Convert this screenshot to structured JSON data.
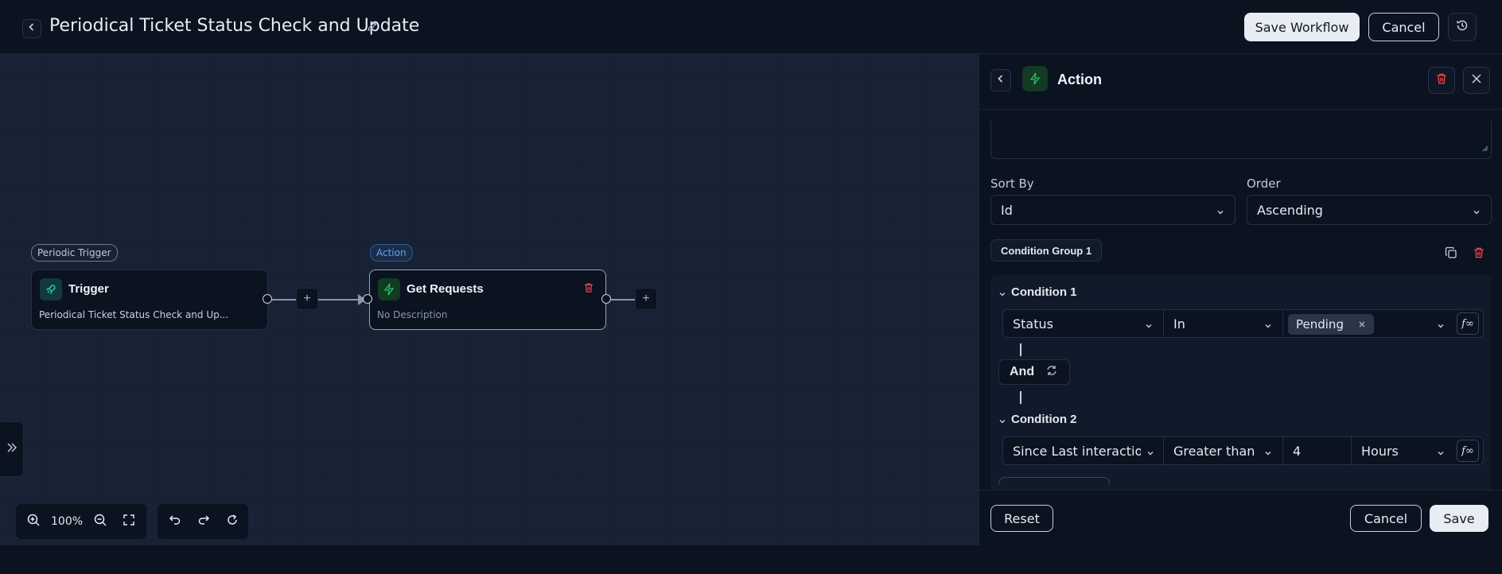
{
  "header": {
    "title": "Periodical Ticket Status Check and Update",
    "save_workflow": "Save Workflow",
    "cancel": "Cancel"
  },
  "canvas": {
    "trigger_node": {
      "pill": "Periodic Trigger",
      "title": "Trigger",
      "subtitle": "Periodical Ticket Status Check and Up..."
    },
    "action_node": {
      "pill": "Action",
      "title": "Get Requests",
      "subtitle": "No Description"
    },
    "zoom_level": "100%"
  },
  "panel": {
    "title": "Action",
    "sort_by_label": "Sort By",
    "sort_by_value": "Id",
    "order_label": "Order",
    "order_value": "Ascending",
    "condition_group_label": "Condition Group 1",
    "condition1": {
      "title": "Condition 1",
      "field": "Status",
      "operator": "In",
      "value_tag": "Pending"
    },
    "connector": "And",
    "condition2": {
      "title": "Condition 2",
      "field": "Since Last interaction",
      "operator": "Greater than",
      "value": "4",
      "unit": "Hours"
    },
    "fx_label": "f∞",
    "reset": "Reset",
    "cancel": "Cancel",
    "save": "Save"
  },
  "colors": {
    "trigger_accent": "#2dd4bf",
    "action_accent": "#22c55e",
    "danger": "#ef4444",
    "pill_action": "#3b82f6"
  }
}
